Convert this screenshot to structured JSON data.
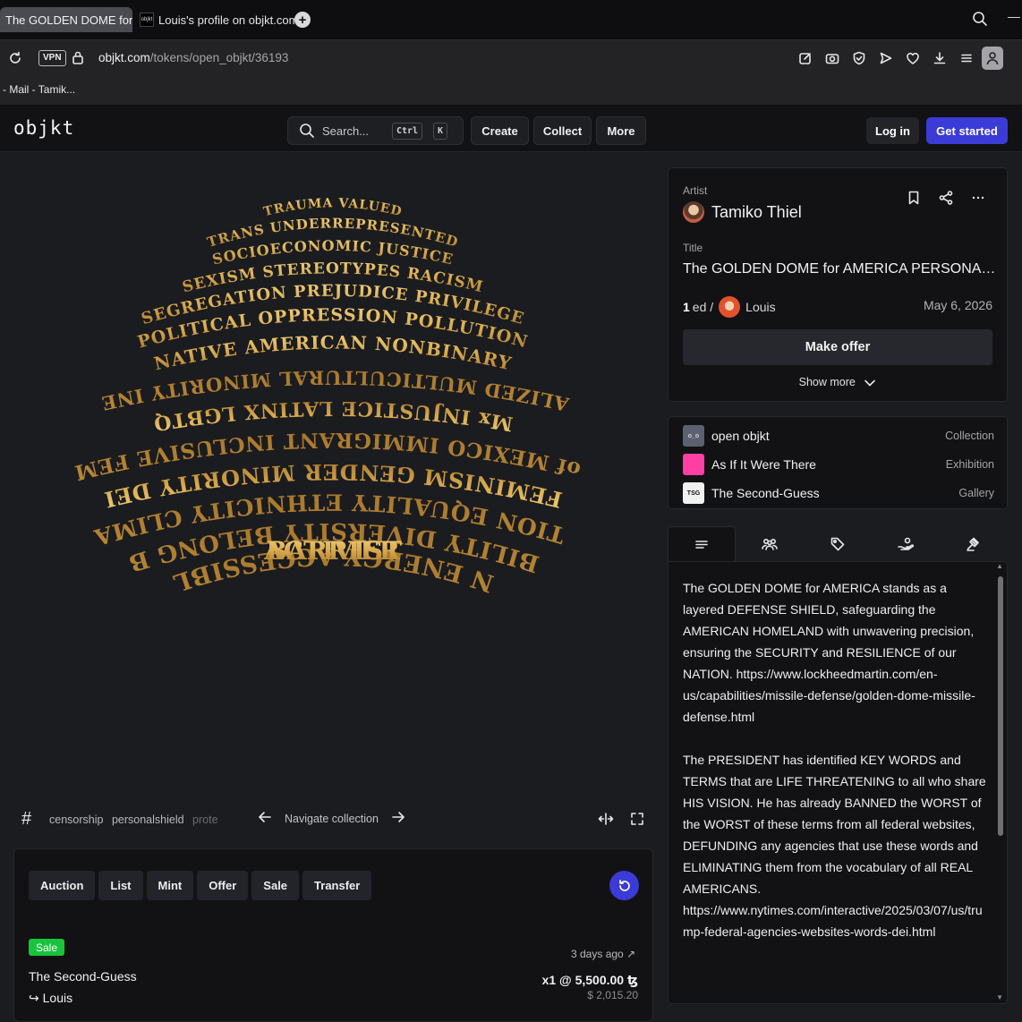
{
  "browser": {
    "tabs": [
      {
        "label": "The GOLDEN DOME for AMERICA PERSONAL SHIELD",
        "active": true
      },
      {
        "label": "Louis's profile on objkt.com",
        "favicon_text": "objkt",
        "active": false
      }
    ],
    "url_host": "objkt.com",
    "url_path": "/tokens/open_objkt/36193",
    "vpn_label": "VPN",
    "bookmark": "- Mail - Tamik..."
  },
  "header": {
    "logo": "objkt",
    "search_placeholder": "Search...",
    "kbd_ctrl": "Ctrl",
    "kbd_k": "K",
    "nav": [
      "Create",
      "Collect",
      "More"
    ],
    "login": "Log in",
    "get_started": "Get started",
    "accent_color": "#3b3bd8"
  },
  "artwork": {
    "words": [
      "TRAUMA",
      "VALUED",
      "TRANS",
      "UNDERREPRESENTED",
      "SOCIOECONOMIC",
      "JUSTICE",
      "SEXISM",
      "STEREOTYPES",
      "RACISM",
      "SEGREGATION",
      "PREJUDICE",
      "PRIVILEGE",
      "POLITICAL",
      "OPPRESSION",
      "POLLUTION",
      "NATIVE",
      "AMERICAN",
      "NONBINARY",
      "MARGINALIZED",
      "MULTICULTURAL",
      "MINORITY",
      "INEQUALITY",
      "Mx",
      "INJUSTICE",
      "LATINX",
      "LGBTQ",
      "GULF of MEXICO",
      "IMMIGRANT",
      "INCLUSIVE",
      "FEMALES",
      "FEMINISM",
      "GENDER",
      "MINORITY",
      "DEI",
      "DISCRIMINATION",
      "EQUALITY",
      "ETHNICITY",
      "CLIMATE SCIENCE",
      "DISABILITY",
      "DIVERSITY",
      "BELONG",
      "BIPOC",
      "BLACK",
      "CLEAN ENERGY",
      "ACCESSIBLE",
      "ADVOCATE",
      "BARRIER",
      "ACTIVIST"
    ],
    "gold_color": "#d8a94c"
  },
  "tags": [
    "censorship",
    "personalshield",
    "prote"
  ],
  "navigate_collection": "Navigate collection",
  "activity": {
    "filters": [
      "Auction",
      "List",
      "Mint",
      "Offer",
      "Sale",
      "Transfer"
    ],
    "event": {
      "badge": "Sale",
      "badge_color": "#19c33d",
      "time_ago": "3 days ago",
      "from": "The Second-Guess",
      "to": "Louis",
      "price": "x1 @ 5,500.00 ꜩ",
      "usd": "$ 2,015.20"
    }
  },
  "token": {
    "artist_label": "Artist",
    "artist": "Tamiko Thiel",
    "title_label": "Title",
    "title": "The GOLDEN DOME for AMERICA PERSONAL SHIELD",
    "editions": "1",
    "ed_suffix": "ed /",
    "owner": "Louis",
    "date": "May 6, 2026",
    "make_offer": "Make offer",
    "show_more": "Show more"
  },
  "collections": [
    {
      "name": "open objkt",
      "type": "Collection",
      "icon_text": "o_o",
      "icon_color": "#5c6070"
    },
    {
      "name": "As If It Were There",
      "type": "Exhibition",
      "icon_text": "",
      "icon_color": "#ff3fa4"
    },
    {
      "name": "The Second-Guess",
      "type": "Gallery",
      "icon_text": "TSG",
      "icon_color": "#f1f1f1"
    }
  ],
  "description": {
    "paragraphs": [
      "The GOLDEN DOME for AMERICA stands as a layered DEFENSE SHIELD, safeguarding the AMERICAN HOMELAND with unwavering precision, ensuring the SECURITY and RESILIENCE of our NATION. https://www.lockheedmartin.com/en-us/capabilities/missile-defense/golden-dome-missile-defense.html",
      "The PRESIDENT has identified KEY WORDS and TERMS that are LIFE THREATENING to all who share HIS VISION. He has already BANNED the WORST of the WORST of these terms from all federal websites, DEFUNDING any agencies that use these words and ELIMINATING them from the vocabulary of all REAL AMERICANS. https://www.nytimes.com/interactive/2025/03/07/us/trump-federal-agencies-websites-words-dei.html"
    ]
  }
}
